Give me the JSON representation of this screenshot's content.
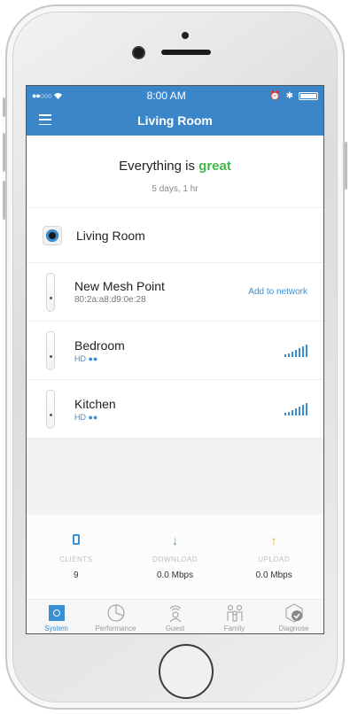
{
  "statusbar": {
    "carrier_dots": "●●○○○",
    "time": "8:00 AM"
  },
  "navbar": {
    "title": "Living Room"
  },
  "status": {
    "headline_prefix": "Everything is",
    "headline_highlight": "great",
    "uptime": "5 days, 1 hr"
  },
  "devices": {
    "main": {
      "name": "Living Room"
    },
    "new_point": {
      "name": "New Mesh Point",
      "mac": "80:2a:a8:d9:0e:28",
      "action": "Add to network"
    },
    "bedroom": {
      "name": "Bedroom",
      "badge": "HD ●●"
    },
    "kitchen": {
      "name": "Kitchen",
      "badge": "HD ●●"
    }
  },
  "stats": {
    "clients": {
      "label": "CLIENTS",
      "value": "9"
    },
    "download": {
      "label": "DOWNLOAD",
      "value": "0.0 Mbps"
    },
    "upload": {
      "label": "UPLOAD",
      "value": "0.0 Mbps"
    }
  },
  "tabs": [
    {
      "label": "System",
      "icon": "system-icon"
    },
    {
      "label": "Performance",
      "icon": "performance-icon"
    },
    {
      "label": "Guest",
      "icon": "guest-icon"
    },
    {
      "label": "Family",
      "icon": "family-icon"
    },
    {
      "label": "Diagnose",
      "icon": "diagnose-icon"
    }
  ],
  "colors": {
    "accent": "#3b86c8",
    "great": "#42b649",
    "upload": "#f2a521"
  }
}
